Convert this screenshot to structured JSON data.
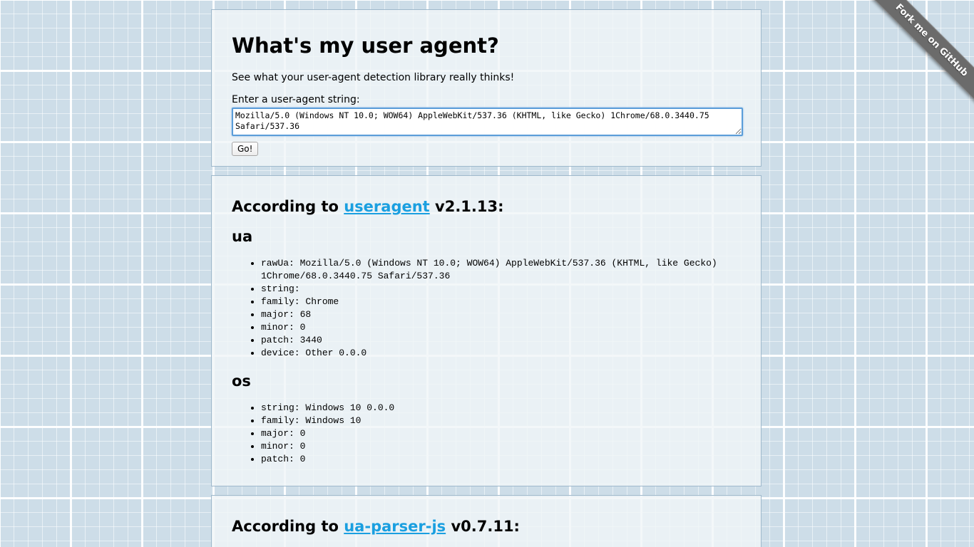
{
  "header": {
    "title": "What's my user agent?",
    "subtitle": "See what your user-agent detection library really thinks!",
    "input_label": "Enter a user-agent string:",
    "input_value": "Mozilla/5.0 (Windows NT 10.0; WOW64) AppleWebKit/537.36 (KHTML, like Gecko) 1Chrome/68.0.3440.75 Safari/537.36",
    "go_label": "Go!"
  },
  "useragent": {
    "prefix": "According to ",
    "lib_name": "useragent",
    "suffix": " v2.1.13:",
    "ua_heading": "ua",
    "ua_items": [
      "rawUa: Mozilla/5.0 (Windows NT 10.0; WOW64) AppleWebKit/537.36 (KHTML, like Gecko) 1Chrome/68.0.3440.75 Safari/537.36",
      "string:",
      "family: Chrome",
      "major: 68",
      "minor: 0",
      "patch: 3440",
      "device: Other 0.0.0"
    ],
    "os_heading": "os",
    "os_items": [
      "string: Windows 10 0.0.0",
      "family: Windows 10",
      "major: 0",
      "minor: 0",
      "patch: 0"
    ]
  },
  "uaparser": {
    "prefix": "According to ",
    "lib_name": "ua-parser-js",
    "suffix": " v0.7.11:"
  },
  "ribbon": {
    "label": "Fork me on GitHub"
  },
  "colors": {
    "link": "#1a9fe0",
    "background": "#cddde8",
    "ribbon": "#6b6b6b",
    "focus_border": "#5b9dd9"
  }
}
